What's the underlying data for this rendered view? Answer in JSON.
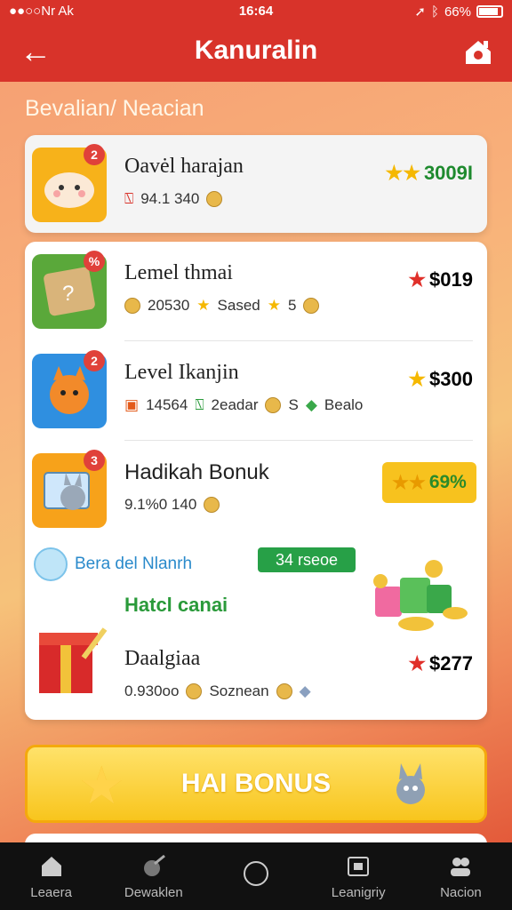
{
  "status_bar": {
    "carrier": "●●○○Nr Ak",
    "time": "16:64",
    "battery": "66%"
  },
  "header": {
    "title": "Kanuralin"
  },
  "section_heading": "Bevalian/ Neacian",
  "cards": [
    {
      "name": "Oavėl harajan",
      "meta": [
        "94.1 340"
      ],
      "reward": "3009I",
      "reward_color": "#1e8a2e",
      "badge": "2"
    },
    {
      "name": "Lemel thmai",
      "meta": [
        "20530",
        "Sased",
        "5"
      ],
      "reward": "$019",
      "reward_color": "#222",
      "badge": "%"
    },
    {
      "name": "Level Ikanjin",
      "meta": [
        "14564",
        "2eadar",
        "S",
        "Bealo"
      ],
      "reward": "$300",
      "reward_color": "#222",
      "badge": "2"
    },
    {
      "name": "Hadikah Bonuk",
      "meta": [
        "9.1%0 140"
      ],
      "reward": "69%",
      "reward_color": "#1e8a2e",
      "badge": "3"
    },
    {
      "name": "Daalgiaa",
      "meta": [
        "0.930oo",
        "Soznean"
      ],
      "reward": "$277",
      "reward_color": "#222"
    }
  ],
  "promo": {
    "bubble_label": "Bera del Nlanrh",
    "green_pill": "34 rseoe",
    "subtitle": "Hatcl canai"
  },
  "big_button_label": "HAI BONUS",
  "tabs": [
    {
      "label": "Leaera"
    },
    {
      "label": "Dewaklen"
    },
    {
      "label": ""
    },
    {
      "label": "Leanigriy"
    },
    {
      "label": "Nacion"
    }
  ]
}
